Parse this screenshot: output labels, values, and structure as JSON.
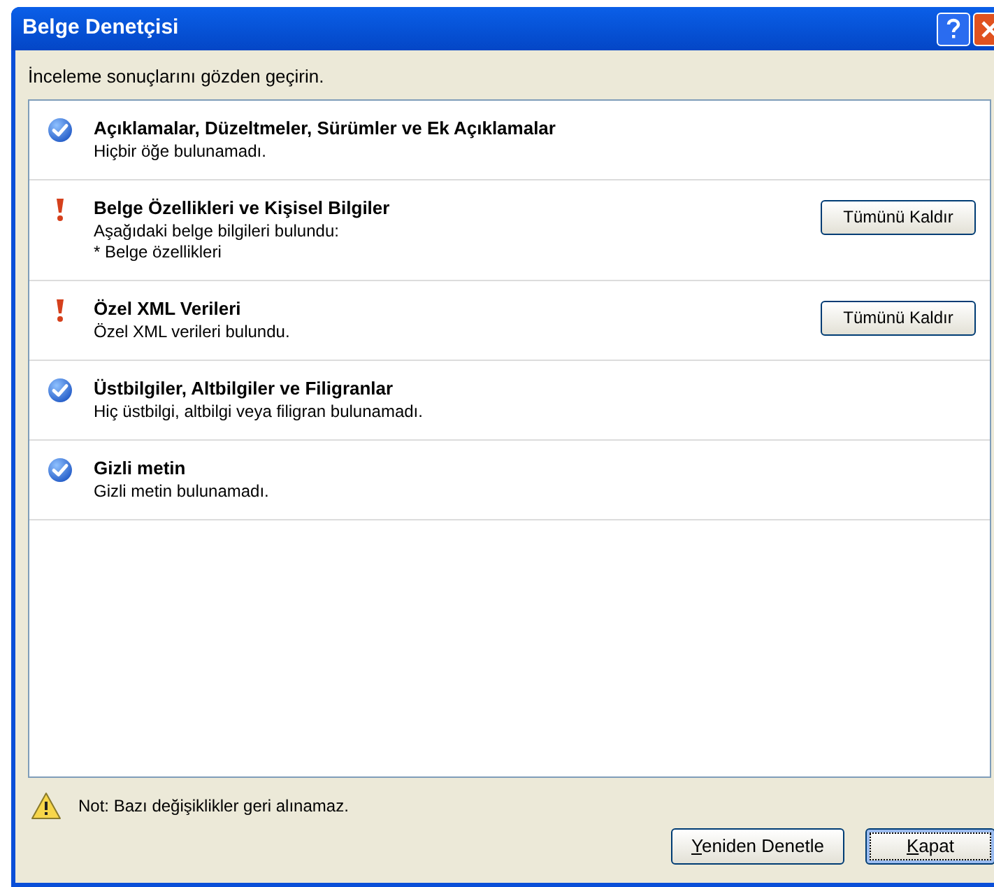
{
  "window": {
    "title": "Belge Denetçisi"
  },
  "instruction": "İnceleme sonuçlarını gözden geçirin.",
  "results": [
    {
      "kind": "ok",
      "title": "Açıklamalar, Düzeltmeler, Sürümler ve Ek Açıklamalar",
      "lines": [
        "Hiçbir öğe bulunamadı."
      ]
    },
    {
      "kind": "warning",
      "title": "Belge Özellikleri ve Kişisel Bilgiler",
      "lines": [
        "Aşağıdaki belge bilgileri bulundu:",
        "* Belge özellikleri"
      ],
      "button": "Tümünü Kaldır"
    },
    {
      "kind": "warning",
      "title": "Özel XML Verileri",
      "lines": [
        "Özel XML verileri bulundu."
      ],
      "button": "Tümünü Kaldır"
    },
    {
      "kind": "ok",
      "title": "Üstbilgiler, Altbilgiler ve Filigranlar",
      "lines": [
        "Hiç üstbilgi, altbilgi veya filigran bulunamadı."
      ]
    },
    {
      "kind": "ok",
      "title": "Gizli metin",
      "lines": [
        "Gizli metin bulunamadı."
      ]
    }
  ],
  "note": "Not: Bazı değişiklikler geri alınamaz.",
  "buttons": [
    {
      "label": "Yeniden Denetle",
      "mnemonic": true,
      "default": false
    },
    {
      "label": "Kapat",
      "mnemonic": true,
      "default": true
    }
  ]
}
